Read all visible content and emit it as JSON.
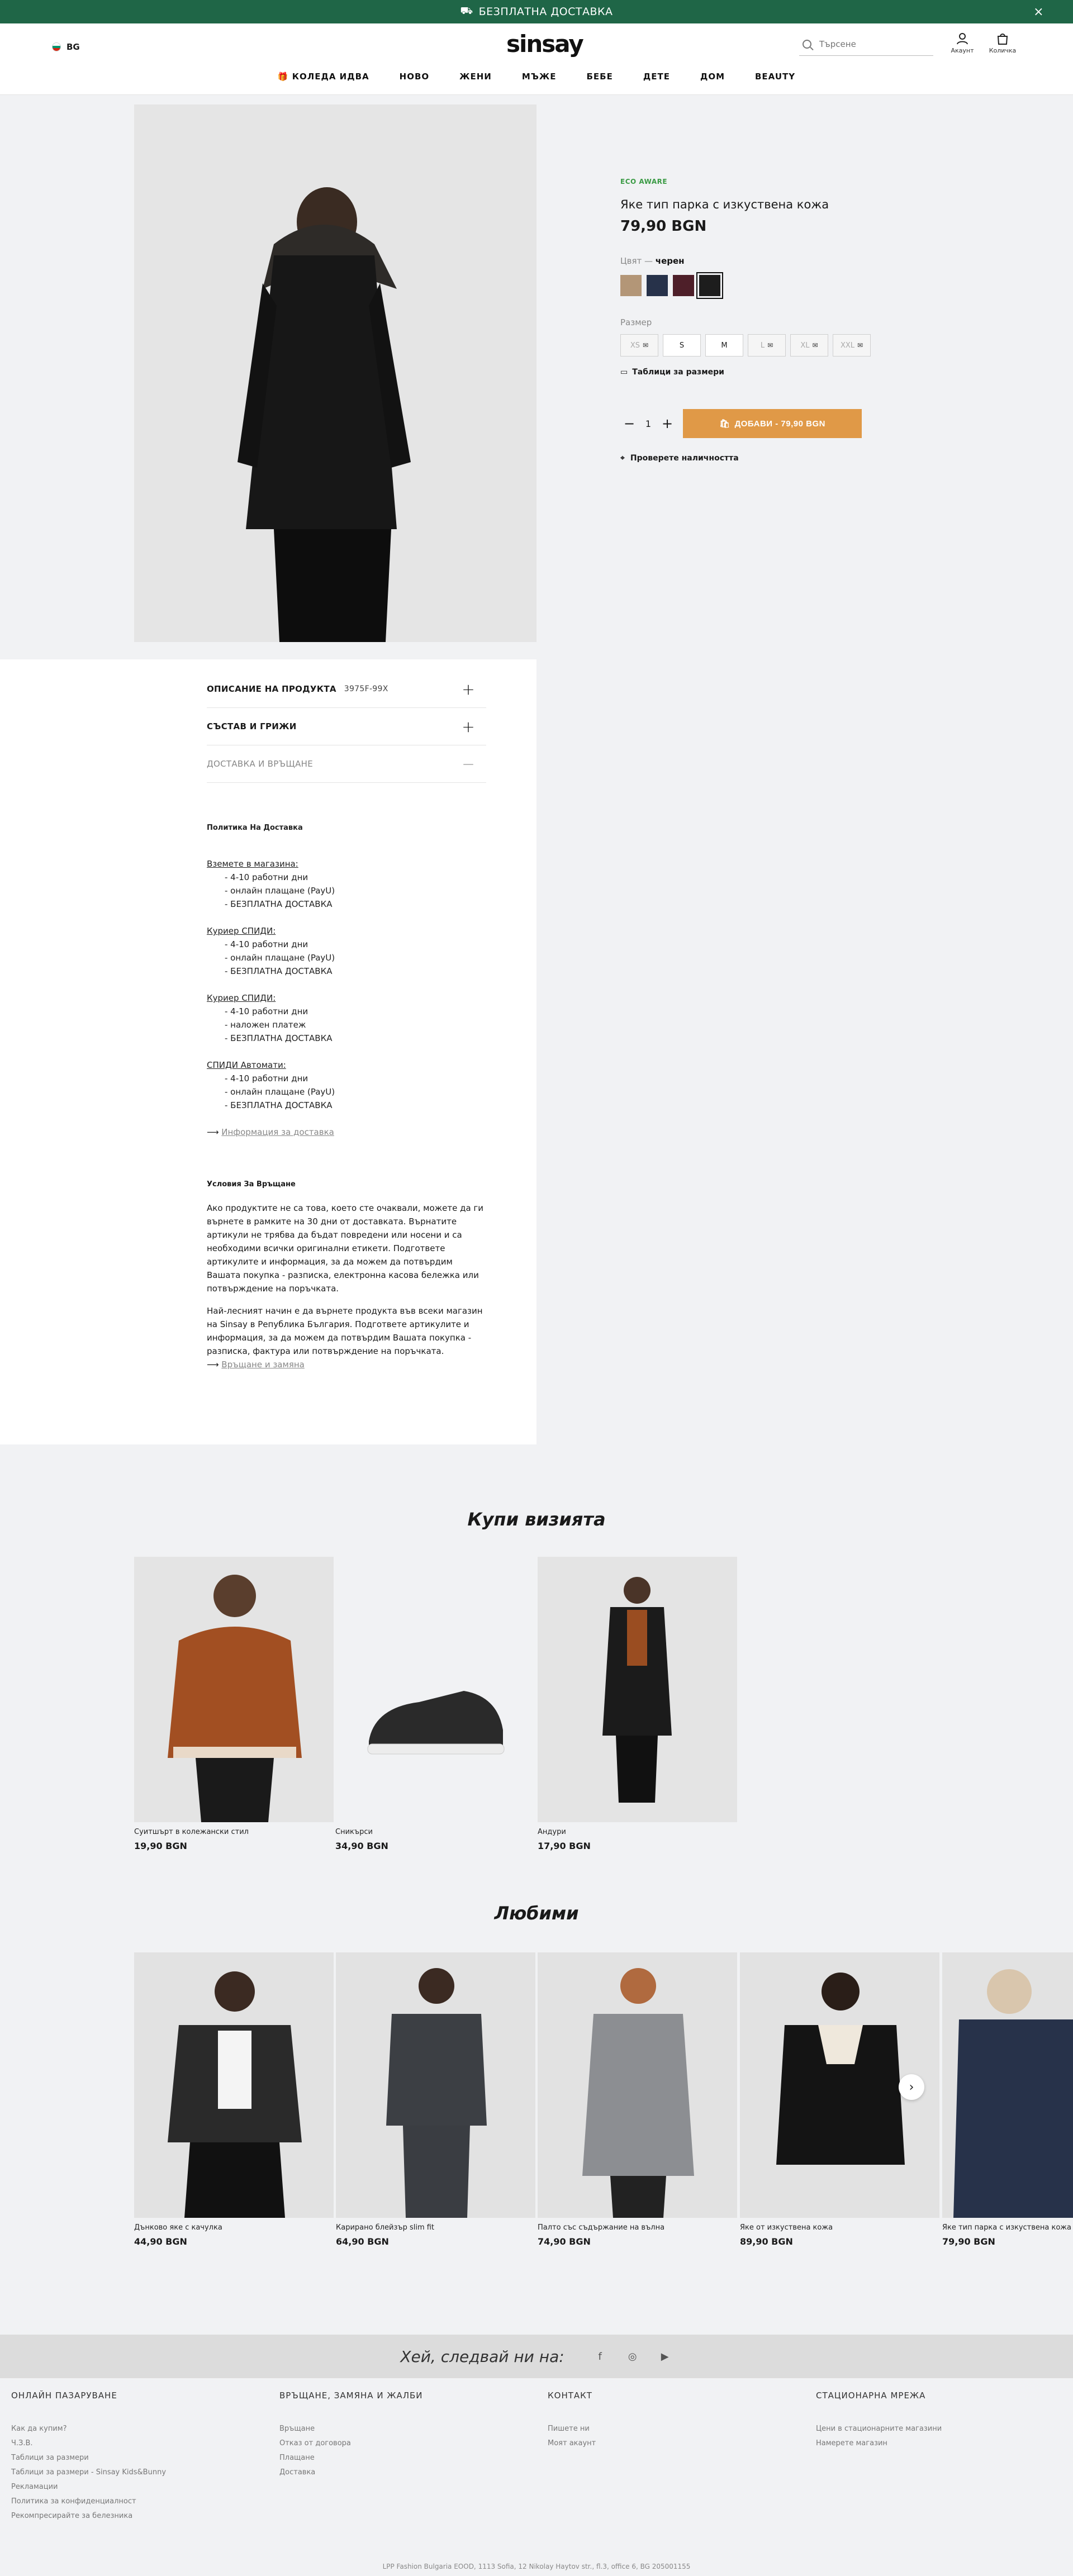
{
  "promo": {
    "text": "БЕЗПЛАТНА ДОСТАВКА",
    "close": "×"
  },
  "header": {
    "lang": "BG",
    "logo": "sinsay",
    "search_placeholder": "Търсене",
    "account": "Акаунт",
    "cart": "Количка"
  },
  "nav": [
    "🎁 КОЛЕДА ИДВА",
    "НОВО",
    "ЖЕНИ",
    "МЪЖЕ",
    "БЕБЕ",
    "ДЕТЕ",
    "ДОМ",
    "BEAUTY"
  ],
  "product": {
    "badge": "ECO AWARE",
    "name": "Яке тип парка с изкуствена кожа",
    "price": "79,90 BGN",
    "color_label": "Цвят — ",
    "color_value": "черен",
    "swatches": [
      {
        "color": "#b39677"
      },
      {
        "color": "#27324a"
      },
      {
        "color": "#4e1f29"
      },
      {
        "color": "#1d1d1d"
      }
    ],
    "size_label": "Размер",
    "sizes": [
      {
        "label": "XS",
        "available": false
      },
      {
        "label": "S",
        "available": true
      },
      {
        "label": "M",
        "available": true
      },
      {
        "label": "L",
        "available": false
      },
      {
        "label": "XL",
        "available": false
      },
      {
        "label": "XXL",
        "available": false
      }
    ],
    "size_table": "Таблици за размери",
    "qty": "1",
    "add_button": "ДОБАВИ - 79,90 BGN",
    "availability": "Проверете наличността"
  },
  "accordion": {
    "desc": "ОПИСАНИЕ НА ПРОДУКТА",
    "sku": "3975F-99X",
    "composition": "СЪСТАВ И ГРИЖИ",
    "delivery": "ДОСТАВКА И ВРЪЩАНЕ"
  },
  "delivery_policy": {
    "title": "Политика На Доставка",
    "groups": [
      {
        "heading": "Вземете в магазина:",
        "items": [
          "- 4-10 работни дни",
          "- онлайн плащане (PayU)",
          "- БЕЗПЛАТНА ДОСТАВКА"
        ]
      },
      {
        "heading": "Куриер СПИДИ:",
        "items": [
          "- 4-10 работни дни",
          "- онлайн плащане (PayU)",
          "- БЕЗПЛАТНА ДОСТАВКА"
        ]
      },
      {
        "heading": "Куриер СПИДИ:",
        "items": [
          "- 4-10 работни дни",
          "- наложен платеж",
          "- БЕЗПЛАТНА ДОСТАВКА"
        ]
      },
      {
        "heading": "СПИДИ Автомати:",
        "items": [
          "- 4-10 работни дни",
          "- онлайн плащане (PayU)",
          "- БЕЗПЛАТНА ДОСТАВКА"
        ]
      }
    ],
    "link": "Информация за доставка"
  },
  "return_policy": {
    "title": "Условия За Връщане",
    "p1": "Ако продуктите не са това, което сте очаквали, можете да ги върнете в рамките на 30 дни от доставката. Върнатите артикули не трябва да бъдат повредени или носени и са необходими всички оригинални етикети. Подгответе артикулите и информация, за да можем да потвърдим Вашата покупка - разписка, електронна касова бележка или потвърждение на поръчката.",
    "p2": "Най-лесният начин е да върнете продукта във всеки магазин на Sinsay в Република България. Подгответе артикулите и информация, за да можем да потвърдим Вашата покупка - разписка, фактура или потвърждение на поръчката.",
    "link": "Връщане и замяна"
  },
  "look": {
    "title": "Купи визията",
    "items": [
      {
        "name": "Суитшърт в колежански стил",
        "price": "19,90 BGN"
      },
      {
        "name": "Сникърси",
        "price": "34,90 BGN"
      },
      {
        "name": "Андури",
        "price": "17,90 BGN"
      }
    ]
  },
  "favorites": {
    "title": "Любими",
    "items": [
      {
        "name": "Дънково яке с качулка",
        "price": "44,90 BGN"
      },
      {
        "name": "Карирано блейзър slim fit",
        "price": "64,90 BGN"
      },
      {
        "name": "Палто със съдържание на вълна",
        "price": "74,90 BGN"
      },
      {
        "name": "Яке от изкуствена кожа",
        "price": "89,90 BGN"
      },
      {
        "name": "Яке тип парка с изкуствена кожа",
        "price": "79,90 BGN"
      }
    ]
  },
  "social": {
    "text": "Хей, следвай ни на:"
  },
  "footer": {
    "cols": [
      {
        "title": "ОНЛАЙН ПАЗАРУВАНЕ",
        "links": [
          "Как да купим?",
          "Ч.З.В.",
          "Таблици за размери",
          "Таблици за размери - Sinsay Kids&Bunny",
          "Рекламации",
          "Политика за конфиденциалност",
          "Рекомпресирайте за белезника"
        ]
      },
      {
        "title": "ВРЪЩАНЕ, ЗАМЯНА И ЖАЛБИ",
        "links": [
          "Връщане",
          "Отказ от договора",
          "Плащане",
          "Доставка"
        ]
      },
      {
        "title": "КОНТАКТ",
        "links": [
          "Пишете ни",
          "Моят акаунт"
        ]
      },
      {
        "title": "СТАЦИОНАРНА МРЕЖА",
        "links": [
          "Цени в стационарните магазини",
          "Намерете магазин"
        ]
      }
    ],
    "copyright": "LPP Fashion Bulgaria EOOD, 1113 Sofia, 12 Nikolay Haytov str., fl.3, office 6, BG 205001155"
  }
}
